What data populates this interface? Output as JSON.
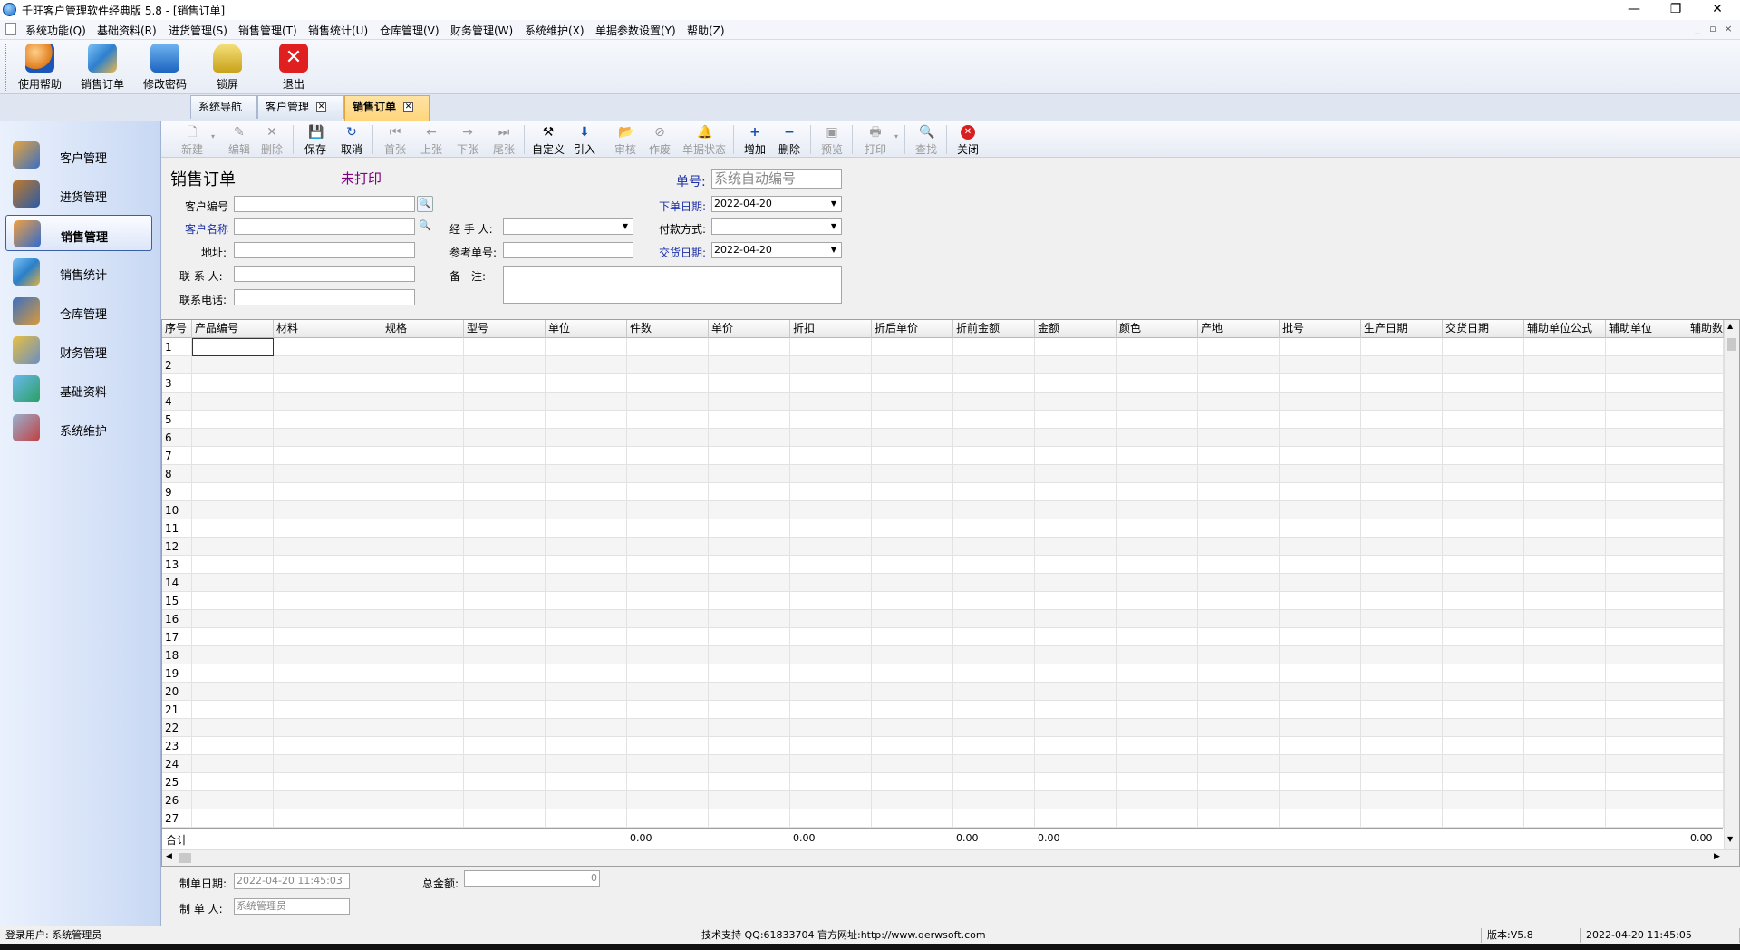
{
  "window": {
    "title": "千旺客户管理软件经典版 5.8 - [销售订单]"
  },
  "menu": [
    "系统功能(Q)",
    "基础资料(R)",
    "进货管理(S)",
    "销售管理(T)",
    "销售统计(U)",
    "仓库管理(V)",
    "财务管理(W)",
    "系统维护(X)",
    "单据参数设置(Y)",
    "帮助(Z)"
  ],
  "big_toolbar": [
    "使用帮助",
    "销售订单",
    "修改密码",
    "锁屏",
    "退出"
  ],
  "tabs": [
    {
      "label": "系统导航"
    },
    {
      "label": "客户管理"
    },
    {
      "label": "销售订单"
    }
  ],
  "left_nav": [
    "客户管理",
    "进货管理",
    "销售管理",
    "销售统计",
    "仓库管理",
    "财务管理",
    "基础资料",
    "系统维护"
  ],
  "form_toolbar": [
    "新建",
    "编辑",
    "删除",
    "保存",
    "取消",
    "首张",
    "上张",
    "下张",
    "尾张",
    "自定义",
    "引入",
    "审核",
    "作废",
    "单据状态",
    "增加",
    "删除",
    "预览",
    "打印",
    "查找",
    "关闭"
  ],
  "form": {
    "title": "销售订单",
    "print_status": "未打印",
    "order_no_label": "单号:",
    "order_no_value": "系统自动编号",
    "cust_code_label": "客户编号",
    "cust_name_label": "客户名称",
    "address_label": "地址:",
    "contact_label": "联 系 人:",
    "phone_label": "联系电话:",
    "handler_label": "经 手 人:",
    "ref_no_label": "参考单号:",
    "remark_label": "备　注:",
    "order_date_label": "下单日期:",
    "order_date_value": "2022-04-20",
    "pay_method_label": "付款方式:",
    "delivery_date_label": "交货日期:",
    "delivery_date_value": "2022-04-20"
  },
  "grid": {
    "columns": [
      "序号",
      "产品编号",
      "材料",
      "规格",
      "型号",
      "单位",
      "件数",
      "单价",
      "折扣",
      "折后单价",
      "折前金额",
      "金额",
      "颜色",
      "产地",
      "批号",
      "生产日期",
      "交货日期",
      "辅助单位公式",
      "辅助单位",
      "辅助数"
    ],
    "rows": [
      "1",
      "2",
      "3",
      "4",
      "5",
      "6",
      "7",
      "8",
      "9",
      "10",
      "11",
      "12",
      "13",
      "14",
      "15",
      "16",
      "17",
      "18",
      "19",
      "20",
      "21",
      "22",
      "23",
      "24",
      "25",
      "26",
      "27"
    ],
    "total_label": "合计",
    "totals": {
      "pieces": "0.00",
      "discount": "0.00",
      "pre_amount": "0.00",
      "amount": "0.00",
      "aux_qty": "0.00"
    }
  },
  "footer": {
    "make_date_label": "制单日期:",
    "make_date_value": "2022-04-20 11:45:03",
    "total_amount_label": "总金额:",
    "total_amount_value": "0",
    "maker_label": "制 单 人:",
    "maker_value": "系统管理员"
  },
  "status": {
    "user": "登录用户: 系统管理员",
    "support": "技术支持 QQ:61833704 官方网址:http://www.qerwsoft.com",
    "version": "版本:V5.8",
    "datetime": "2022-04-20 11:45:05"
  },
  "colors": {
    "accent": "#ffd57a",
    "nav_bg": "#c8d8f3",
    "label_blue": "#1c2fa6",
    "print_status": "#800080"
  }
}
